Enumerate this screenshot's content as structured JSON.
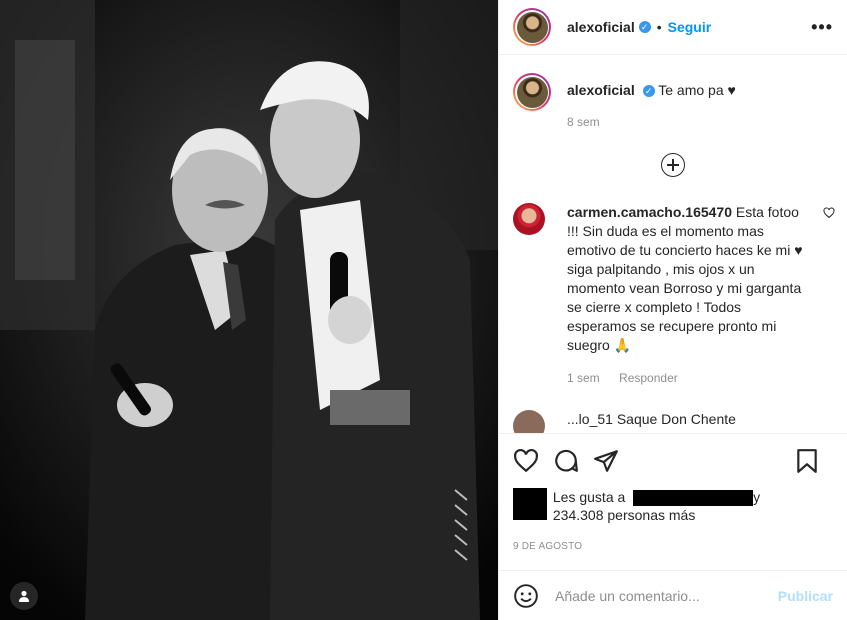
{
  "post": {
    "username": "alexoficial",
    "follow_label": "Seguir",
    "separator": "•",
    "more_label": "•••",
    "caption": {
      "username": "alexoficial",
      "text": "Te amo pa ♥",
      "time": "8 sem"
    },
    "comments": [
      {
        "username": "carmen.camacho.165470",
        "text": "Esta fotoo !!! Sin duda es el momento mas emotivo de tu concierto haces ke mi ♥ siga palpitando , mis ojos x un momento vean Borroso y mi garganta se cierre x completo ! Todos esperamos se recupere pronto mi suegro 🙏",
        "time": "1 sem",
        "reply_label": "Responder"
      }
    ],
    "next_comment_partial": "...lo_51 Saque Don Chente",
    "likes": {
      "prefix": "Les gusta a",
      "connector": "y",
      "count": "234.308 personas más"
    },
    "date": "9 DE AGOSTO",
    "add_comment_placeholder": "Añade un comentario...",
    "publish_label": "Publicar"
  },
  "colors": {
    "link": "#0095f6",
    "publish_disabled": "#b2dffc",
    "verified": "#3897f0"
  },
  "icons": [
    "user-tag-icon",
    "verified-icon",
    "more-icon",
    "plus-circle-icon",
    "heart-icon",
    "comment-icon",
    "share-icon",
    "bookmark-icon",
    "emoji-icon"
  ]
}
